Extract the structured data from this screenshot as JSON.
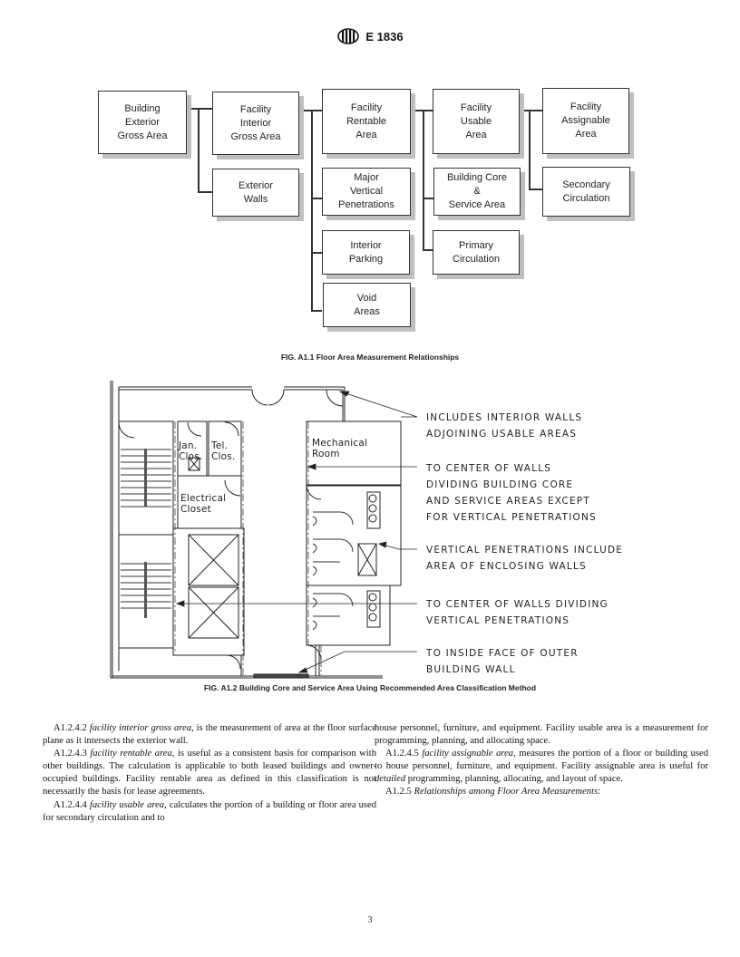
{
  "header": {
    "logo_icon": "astm-logo-icon",
    "standard_number": "E 1836"
  },
  "figure1": {
    "caption": "FIG. A1.1 Floor Area Measurement Relationships",
    "boxes": [
      {
        "id": "building-exterior-gross-area",
        "label": "Building\nExterior\nGross Area"
      },
      {
        "id": "facility-interior-gross-area",
        "label": "Facility\nInterior\nGross Area"
      },
      {
        "id": "exterior-walls",
        "label": "Exterior\nWalls"
      },
      {
        "id": "facility-rentable-area",
        "label": "Facility\nRentable\nArea"
      },
      {
        "id": "major-vertical-penetrations",
        "label": "Major\nVertical\nPenetrations"
      },
      {
        "id": "interior-parking",
        "label": "Interior\nParking"
      },
      {
        "id": "void-areas",
        "label": "Void\nAreas"
      },
      {
        "id": "facility-usable-area",
        "label": "Facility\nUsable\nArea"
      },
      {
        "id": "building-core-service-area",
        "label": "Building Core\n&\nService Area"
      },
      {
        "id": "primary-circulation",
        "label": "Primary\nCirculation"
      },
      {
        "id": "facility-assignable-area",
        "label": "Facility\nAssignable\nArea"
      },
      {
        "id": "secondary-circulation",
        "label": "Secondary\nCirculation"
      }
    ]
  },
  "figure2": {
    "caption": "FIG. A1.2 Building Core and Service Area Using Recommended Area Classification Method",
    "room_labels": {
      "jan_clos": "Jan.\nClos.",
      "tel_clos": "Tel.\nClos.",
      "electrical_closet": "Electrical\nCloset",
      "mechanical_room": "Mechanical\nRoom"
    },
    "notes": [
      "INCLUDES INTERIOR WALLS\nADJOINING USABLE AREAS",
      "TO CENTER OF WALLS\nDIVIDING BUILDING CORE\nAND SERVICE AREAS EXCEPT\nFOR VERTICAL PENETRATIONS",
      "VERTICAL PENETRATIONS INCLUDE\nAREA OF ENCLOSING WALLS",
      "TO CENTER OF WALLS DIVIDING\nVERTICAL PENETRATIONS",
      "TO INSIDE FACE OF OUTER\nBUILDING WALL"
    ]
  },
  "body": {
    "left": [
      {
        "num": "A1.2.4.2",
        "term": "facility interior gross area",
        "text": ", is the measurement of area at the floor surface plane as it intersects the exterior wall."
      },
      {
        "num": "A1.2.4.3",
        "term": "facility rentable area",
        "text": ", is useful as a consistent basis for comparison with other buildings. The calculation is applicable to both leased buildings and owner-occupied buildings. Facility rentable area as defined in this classification is not necessarily the basis for lease agreements."
      },
      {
        "num": "A1.2.4.4",
        "term": "facility usable area",
        "text": ", calculates the portion of a building or floor area used for secondary circulation and to"
      }
    ],
    "right_continuation": "house personnel, furniture, and equipment. Facility usable area is a measurement for programming, planning, and allocating space.",
    "right_para": {
      "num": "A1.2.4.5",
      "term": "facility assignable area",
      "text_before": ", measures the portion of a floor or building used to house personnel, furniture, and equipment. Facility assignable area is useful for ",
      "emph": "detailed",
      "text_after": " programming, planning, allocating, and layout of space."
    },
    "section": {
      "num": "A1.2.5",
      "title": "Relationships among Floor Area Measurements",
      "suffix": ":"
    }
  },
  "page_number": "3"
}
